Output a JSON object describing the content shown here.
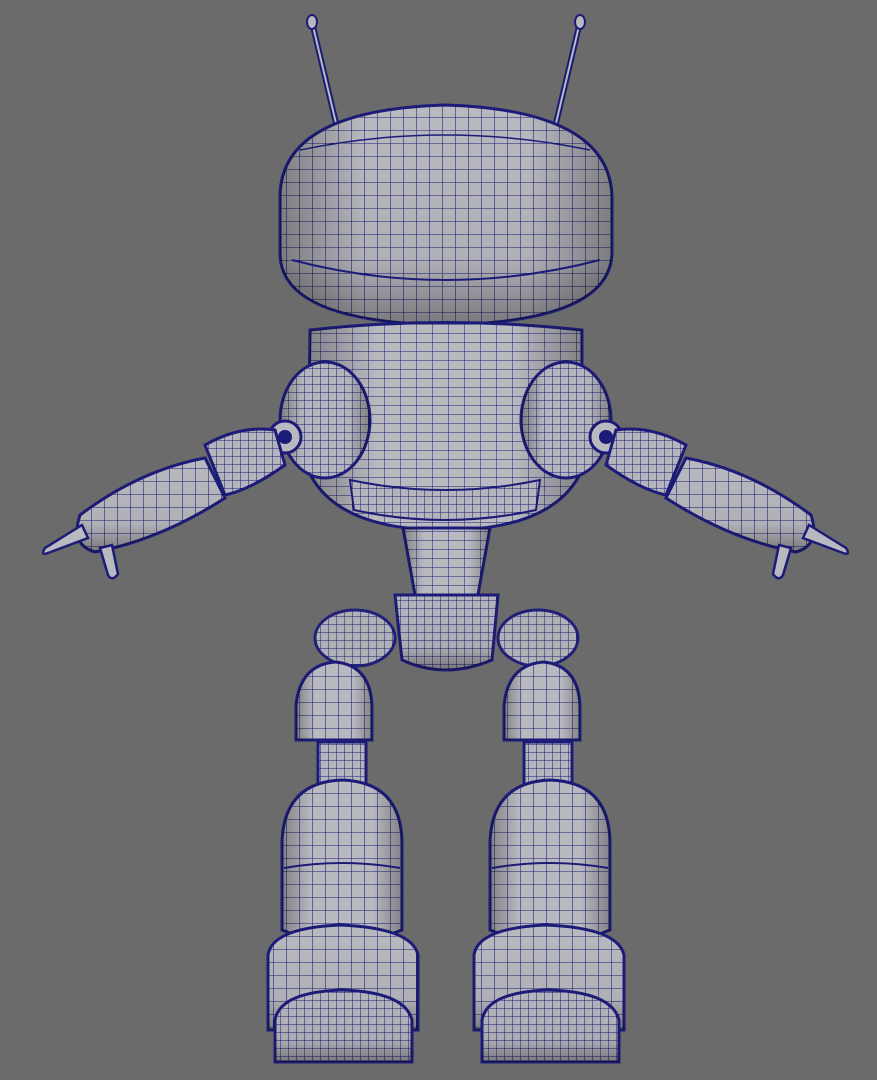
{
  "viewport": {
    "background_color": "#6b6b6b",
    "shading_color": "#b9b9c0",
    "shadow_color": "#8e8e99",
    "wire_color": "#1c1c78",
    "display_mode": "wireframe-on-shaded",
    "subject": "robot-model"
  }
}
